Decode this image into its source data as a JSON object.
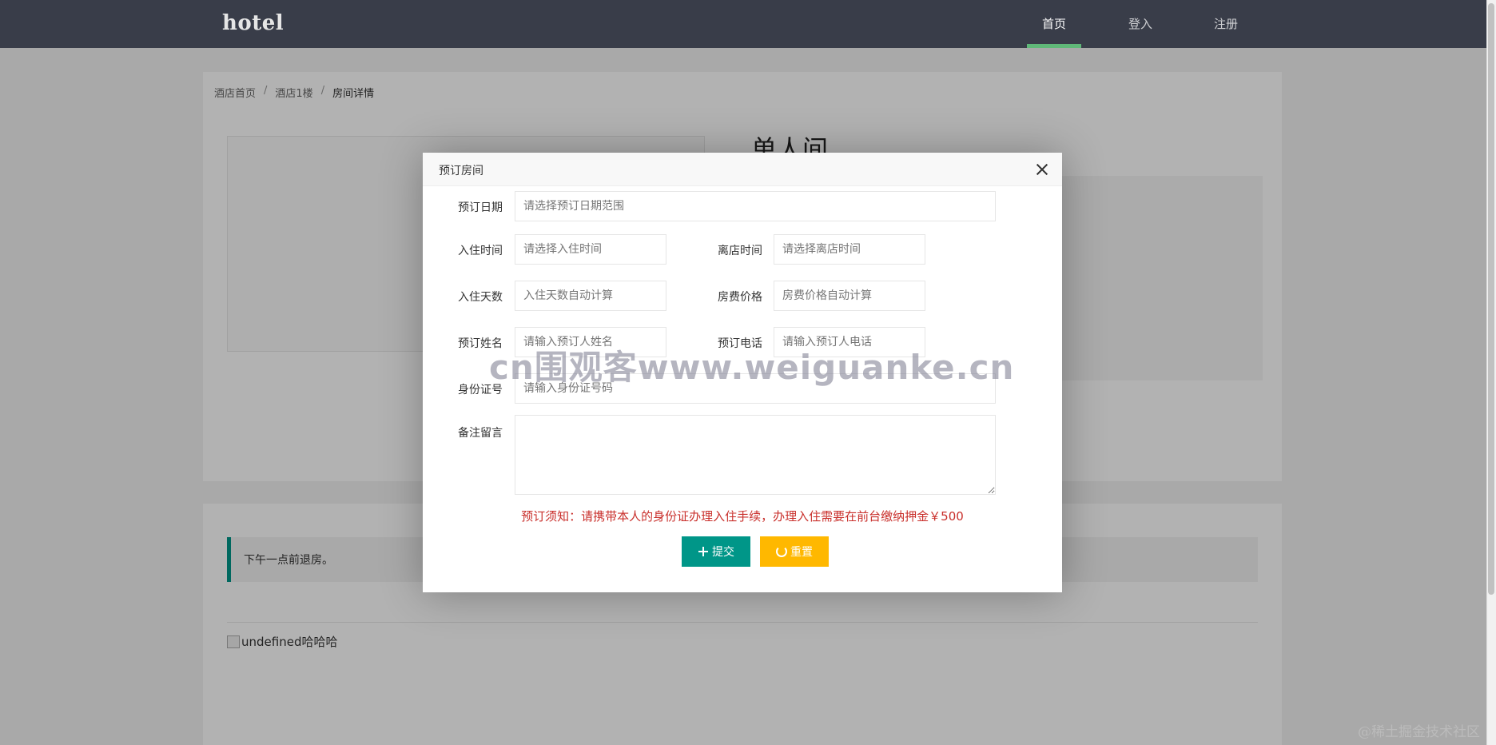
{
  "app": {
    "logo": "hotel"
  },
  "nav": {
    "items": [
      {
        "label": "首页",
        "active": true
      },
      {
        "label": "登入",
        "active": false
      },
      {
        "label": "注册",
        "active": false
      }
    ]
  },
  "breadcrumb": {
    "items": [
      "酒店首页",
      "酒店1楼",
      "房间详情"
    ],
    "separator": "/"
  },
  "room": {
    "title": "单人间"
  },
  "details": {
    "notice": "下午一点前退房。",
    "broken_image_text": "undefined哈哈哈"
  },
  "modal": {
    "title": "预订房间",
    "fields": {
      "date_range": {
        "label": "预订日期",
        "placeholder": "请选择预订日期范围"
      },
      "checkin_time": {
        "label": "入住时间",
        "placeholder": "请选择入住时间"
      },
      "checkout_time": {
        "label": "离店时间",
        "placeholder": "请选择离店时间"
      },
      "days": {
        "label": "入住天数",
        "placeholder": "入住天数自动计算"
      },
      "price": {
        "label": "房费价格",
        "placeholder": "房费价格自动计算"
      },
      "name": {
        "label": "预订姓名",
        "placeholder": "请输入预订人姓名"
      },
      "phone": {
        "label": "预订电话",
        "placeholder": "请输入预订人电话"
      },
      "id_number": {
        "label": "身份证号",
        "placeholder": "请输入身份证号码"
      },
      "remark": {
        "label": "备注留言",
        "placeholder": ""
      }
    },
    "notice": "预订须知：请携带本人的身份证办理入住手续，办理入住需要在前台缴纳押金￥500",
    "submit_label": "提交",
    "reset_label": "重置"
  },
  "watermark": "cn围观客www.weiguanke.cn",
  "corner_watermark": "@稀土掘金技术社区",
  "colors": {
    "topbar": "#393d49",
    "accent_green": "#009688",
    "nav_active_bar": "#5fb878",
    "reset_yellow": "#ffb800",
    "notice_red": "#c9302c"
  }
}
